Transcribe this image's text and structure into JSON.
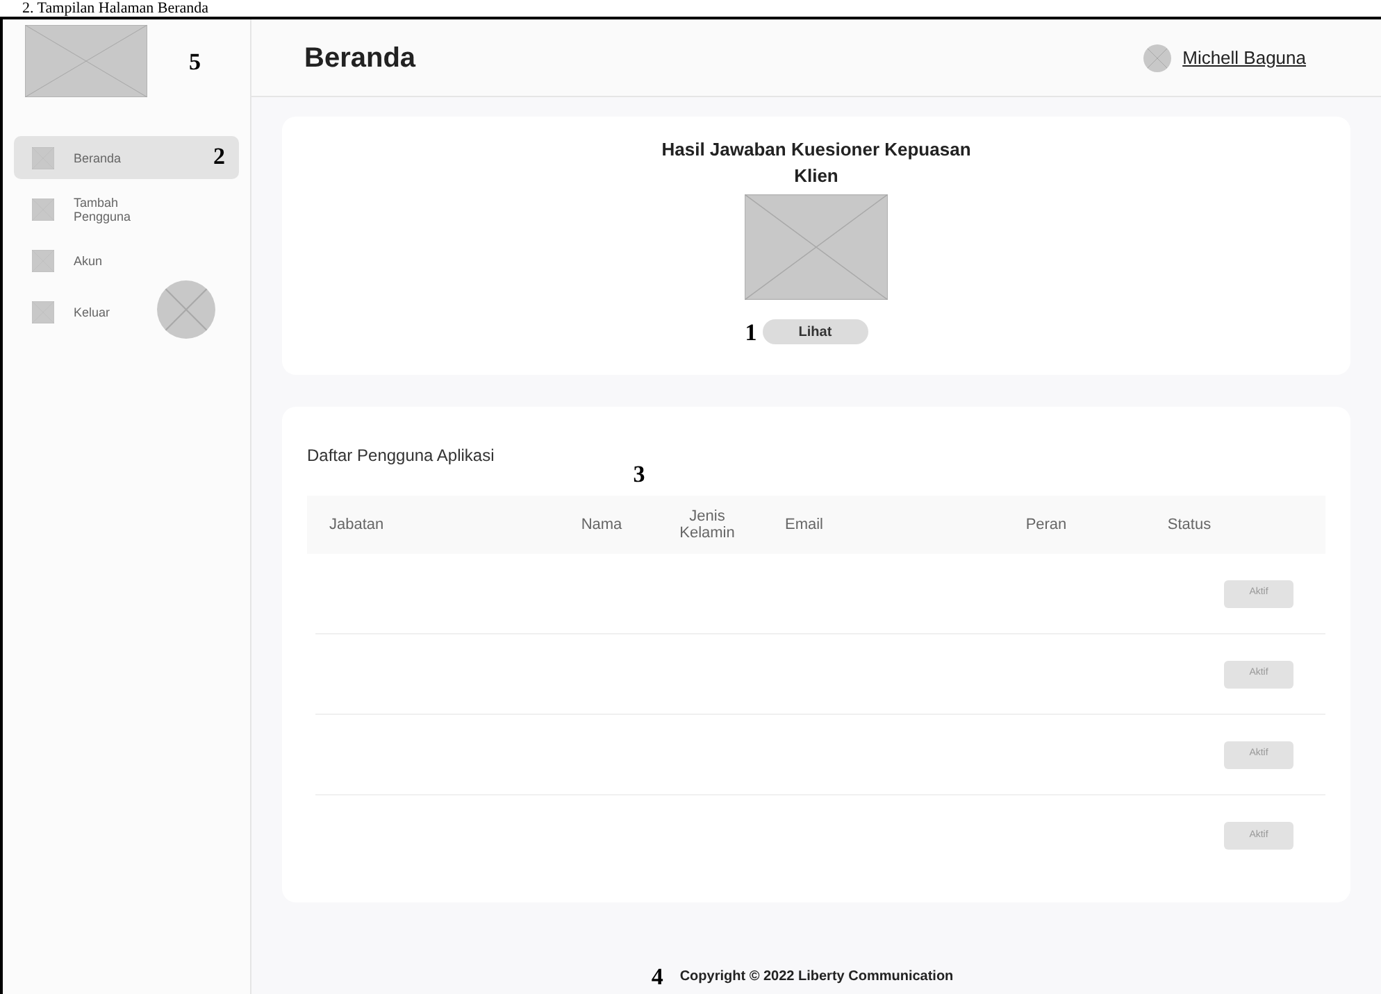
{
  "document_heading": "2.    Tampilan Halaman Beranda",
  "sidebar": {
    "logo_annotation": "5",
    "items": [
      {
        "label": "Beranda",
        "selected": true,
        "annotation": "2"
      },
      {
        "label": "Tambah Pengguna",
        "selected": false
      },
      {
        "label": "Akun",
        "selected": false
      },
      {
        "label": "Keluar",
        "selected": false,
        "extra_placeholder": true
      }
    ]
  },
  "header": {
    "title": "Beranda",
    "user": "Michell Baguna"
  },
  "survey_card": {
    "title": "Hasil Jawaban Kuesioner Kepuasan Klien",
    "button": "Lihat",
    "annotation": "1"
  },
  "users_card": {
    "title": "Daftar Pengguna Aplikasi",
    "annotation": "3",
    "columns": [
      "Jabatan",
      "Nama",
      "Jenis Kelamin",
      "Email",
      "Peran",
      "Status"
    ],
    "rows": [
      {
        "status": "Aktif"
      },
      {
        "status": "Aktif"
      },
      {
        "status": "Aktif"
      },
      {
        "status": "Aktif"
      }
    ]
  },
  "footer": {
    "text": "Copyright © 2022 Liberty Communication",
    "annotation": "4"
  }
}
